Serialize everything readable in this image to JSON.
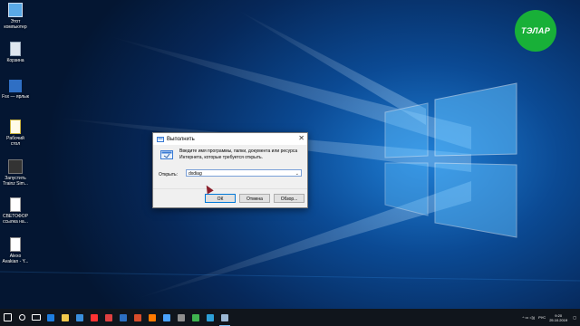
{
  "desktop": {
    "icons": [
      {
        "label": "Этот компьютер",
        "icon": "computer-icon"
      },
      {
        "label": "Корзина",
        "icon": "recycle-bin-icon"
      },
      {
        "label": "Fsx — ярлык",
        "icon": "airplane-icon"
      },
      {
        "label": "Рабочий стол",
        "icon": "document-icon"
      },
      {
        "label": "Запустить Trainz Sim...",
        "icon": "train-icon"
      },
      {
        "label": "СВЕТОФОР ссылка на...",
        "icon": "document-icon"
      },
      {
        "label": "Alexo Avakian - Y...",
        "icon": "audio-file-icon"
      }
    ],
    "logo_text": "ТЭЛАР"
  },
  "run_dialog": {
    "title": "Выполнить",
    "description": "Введите имя программы, папки, документа или ресурса Интернета, которые требуется открыть.",
    "open_label": "Открыть:",
    "input_value": "dxdiag",
    "ok_label": "ОК",
    "cancel_label": "Отмена",
    "browse_label": "Обзор..."
  },
  "taskbar": {
    "items": [
      {
        "name": "start-button",
        "color": "#ffffff"
      },
      {
        "name": "search-icon",
        "color": "#ffffff"
      },
      {
        "name": "task-view-icon",
        "color": "#ffffff"
      },
      {
        "name": "edge-icon",
        "color": "#1e7ee0"
      },
      {
        "name": "file-explorer-icon",
        "color": "#f2c94c"
      },
      {
        "name": "store-icon",
        "color": "#3a8fdc"
      },
      {
        "name": "yandex-browser-icon",
        "color": "#ff3333"
      },
      {
        "name": "app-icon-1",
        "color": "#e04040"
      },
      {
        "name": "app-icon-2",
        "color": "#2c6fc2"
      },
      {
        "name": "app-icon-3",
        "color": "#d94d2b"
      },
      {
        "name": "app-icon-4",
        "color": "#ff7a00"
      },
      {
        "name": "app-icon-5",
        "color": "#4aa3ff"
      },
      {
        "name": "app-icon-6",
        "color": "#8f8f8f"
      },
      {
        "name": "app-icon-7",
        "color": "#3fb34f"
      },
      {
        "name": "app-icon-8",
        "color": "#2da0d8"
      },
      {
        "name": "run-app-icon",
        "color": "#9bb7d4"
      }
    ],
    "language": "РУС",
    "time": "9:20",
    "date": "25.10.2019"
  }
}
